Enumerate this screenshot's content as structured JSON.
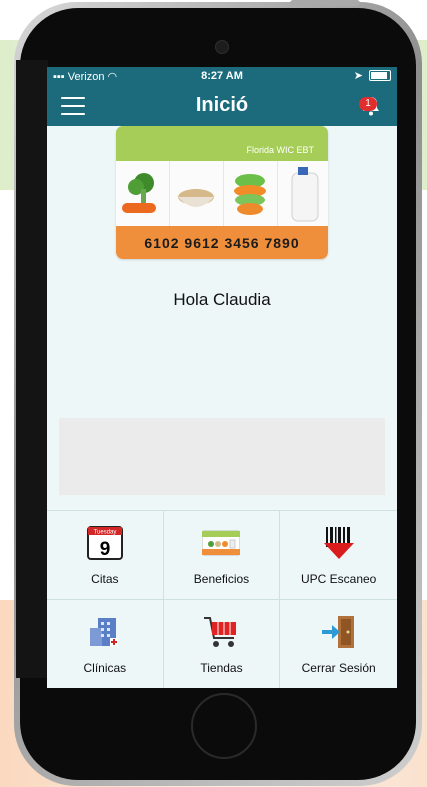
{
  "status_bar": {
    "carrier": "Verizon",
    "time": "8:27 AM"
  },
  "header": {
    "title": "Inició",
    "notification_count": "1"
  },
  "card": {
    "brand": "Florida WIC EBT",
    "number": "6102 9612 3456 7890"
  },
  "greeting": "Hola Claudia",
  "calendar_icon": {
    "day_name": "Tuesday",
    "day_number": "9"
  },
  "tiles": [
    {
      "label": "Citas",
      "icon": "calendar-icon"
    },
    {
      "label": "Beneficios",
      "icon": "benefits-card-icon"
    },
    {
      "label": "UPC Escaneo",
      "icon": "barcode-scan-icon"
    },
    {
      "label": "Clínicas",
      "icon": "clinic-building-icon"
    },
    {
      "label": "Tiendas",
      "icon": "shopping-cart-icon"
    },
    {
      "label": "Cerrar Sesión",
      "icon": "logout-door-icon"
    }
  ],
  "colors": {
    "primary": "#1c6b7c",
    "badge": "#e02d2d",
    "card_green": "#a6cd58",
    "card_orange": "#f08f3b"
  }
}
